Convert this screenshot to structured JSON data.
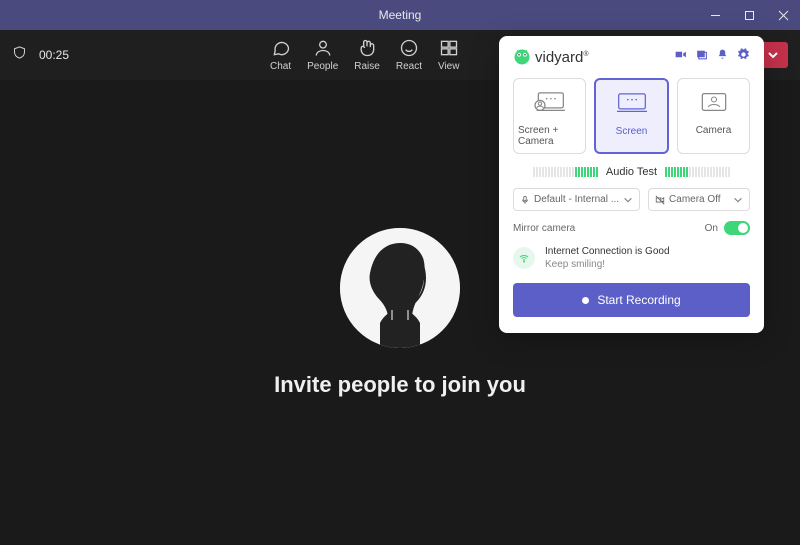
{
  "window": {
    "title": "Meeting"
  },
  "toolbar": {
    "timer": "00:25",
    "chat": "Chat",
    "people": "People",
    "raise": "Raise",
    "react": "React",
    "view": "View"
  },
  "stage": {
    "invite": "Invite people to join you"
  },
  "vidyard": {
    "brand": "vidyard",
    "modes": {
      "screen_camera": "Screen + Camera",
      "screen": "Screen",
      "camera": "Camera"
    },
    "audio_test": "Audio Test",
    "mic_select": "Default - Internal ...",
    "camera_select": "Camera Off",
    "mirror_label": "Mirror camera",
    "mirror_state": "On",
    "connection_title": "Internet Connection is Good",
    "connection_sub": "Keep smiling!",
    "start_recording": "Start Recording"
  }
}
